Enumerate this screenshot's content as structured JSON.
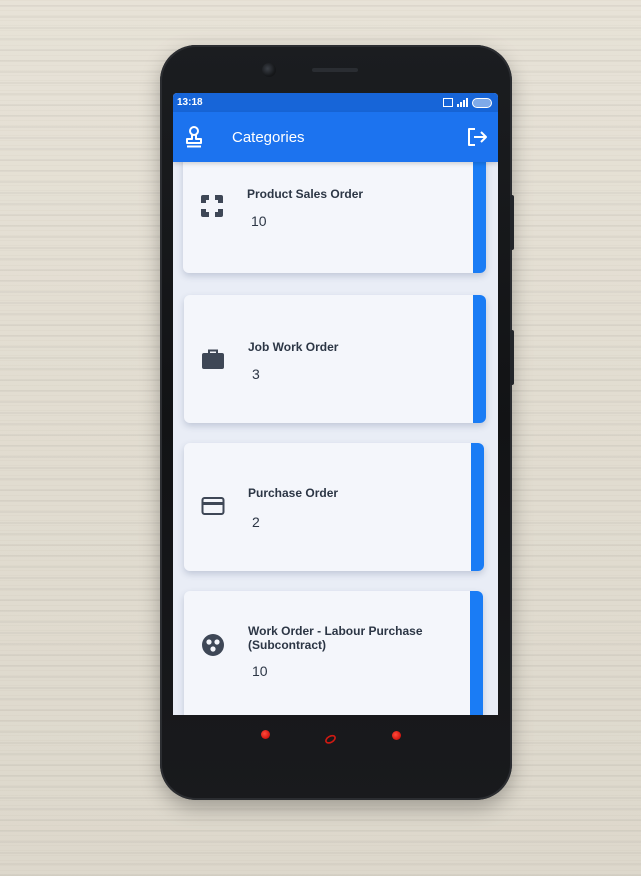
{
  "status_bar": {
    "time": "13:18"
  },
  "appbar": {
    "title": "Categories",
    "left_icon": "stamp-icon",
    "right_icon": "logout-icon",
    "bar_color": "#1c73ef"
  },
  "cards": [
    {
      "title": "Product Sales Order",
      "count": "10",
      "icon": "fullscreen-icon"
    },
    {
      "title": "Job Work Order",
      "count": "3",
      "icon": "briefcase-icon"
    },
    {
      "title": "Purchase Order",
      "count": "2",
      "icon": "credit-card-icon"
    },
    {
      "title": "Work Order - Labour Purchase (Subcontract)",
      "count": "10",
      "icon": "group-work-icon"
    }
  ],
  "colors": {
    "accent": "#1a7cf5",
    "card_background": "#f4f6fb",
    "text": "#2c3645"
  }
}
